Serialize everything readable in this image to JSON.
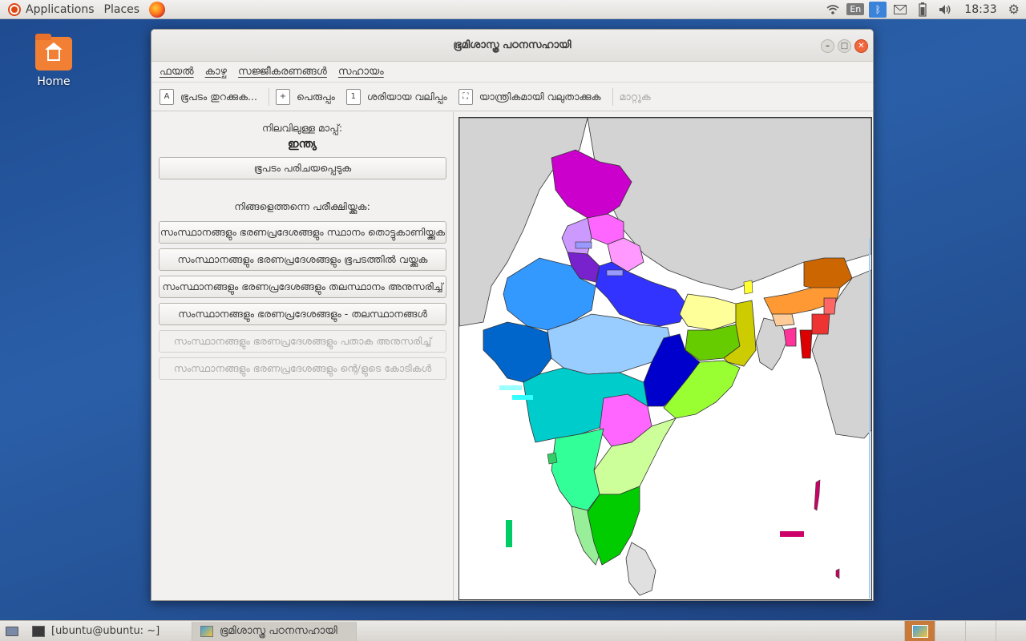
{
  "top_panel": {
    "applications": "Applications",
    "places": "Places",
    "keyboard_layout": "En",
    "clock": "18:33"
  },
  "desktop": {
    "home_label": "Home"
  },
  "window": {
    "title": "ഭൂമിശാസ്ത്ര പഠനസഹായി",
    "menu": [
      "ഫയൽ",
      "കാഴ്ച",
      "സജ്ജീകരണങ്ങൾ",
      "സഹായം"
    ],
    "toolbar": {
      "open_map": "ഭൂപടം തുറക്കുക...",
      "zoom_in": "പെരുപ്പം",
      "actual_size": "ശരിയായ വലിപ്പം",
      "auto_zoom": "യാന്ത്രികമായി വലുതാക്കുക",
      "move": "മാറ്റുക"
    },
    "left": {
      "current_map_label": "നിലവിലുള്ള മാപ്പ്:",
      "current_map": "ഇന്ത്യ",
      "intro_button": "ഭൂപടം പരിചയപ്പെടുക",
      "test_label": "നിങ്ങളെത്തന്നെ പരീക്ഷിയ്ക്കുക:",
      "quiz_buttons": [
        {
          "label": "സംസ്ഥാനങ്ങളും ഭരണപ്രദേശങ്ങളും സ്ഥാനം തൊട്ടുകാണിയ്ക്കുക",
          "enabled": true
        },
        {
          "label": "സംസ്ഥാനങ്ങളും ഭരണപ്രദേശങ്ങളും ഭൂപടത്തിൽ വയ്ക്കുക",
          "enabled": true
        },
        {
          "label": "സംസ്ഥാനങ്ങളും ഭരണപ്രദേശങ്ങളും തലസ്ഥാനം അനുസരിച്ച്",
          "enabled": true
        },
        {
          "label": "സംസ്ഥാനങ്ങളും ഭരണപ്രദേശങ്ങളും - തലസ്ഥാനങ്ങൾ",
          "enabled": true
        },
        {
          "label": "സംസ്ഥാനങ്ങളും ഭരണപ്രദേശങ്ങളും പതാക അനുസരിച്ച്",
          "enabled": false
        },
        {
          "label": "സംസ്ഥാനങ്ങളും ഭരണപ്രദേശങ്ങളും ന്റെ/ളുടെ കോടികൾ",
          "enabled": false
        }
      ]
    }
  },
  "taskbar": {
    "terminal": "[ubuntu@ubuntu: ~]",
    "app": "ഭൂമിശാസ്ത്ര പഠനസഹായി"
  },
  "colors": {
    "window_bg": "#f2f1f0",
    "neighbor_gray": "#d3d3d3",
    "sea": "#ffffff"
  }
}
